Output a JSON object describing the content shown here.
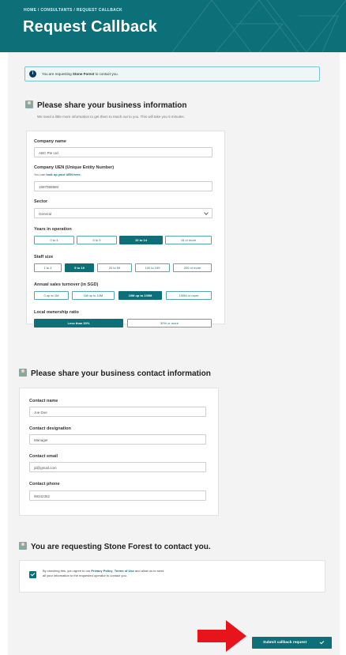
{
  "header": {
    "breadcrumb": [
      "HOME",
      "CONSULTANTS",
      "REQUEST CALLBACK"
    ],
    "breadcrumb_sep": "/",
    "title": "Request Callback"
  },
  "notice": {
    "prefix": "You are requesting ",
    "company": "Stone Forest",
    "suffix": " to contact you."
  },
  "business": {
    "title": "Please share your business information",
    "subtitle": "We need a little more information to get them to reach out to you. This will take you 5 minutes.",
    "company_name": {
      "label": "Company name",
      "value": "ABC Pte Ltd"
    },
    "uen": {
      "label": "Company UEN (Unique Entity Number)",
      "helper_prefix": "You can ",
      "helper_link": "look up your UEN here.",
      "value": "19970859IM"
    },
    "sector": {
      "label": "Sector",
      "value": "General"
    },
    "years": {
      "label": "Years in operation",
      "options": [
        "0 to 4",
        "5 to 9",
        "10 to 14",
        "15 or more"
      ],
      "selected": "10 to 14"
    },
    "staff": {
      "label": "Staff size",
      "options": [
        "1 to 4",
        "5 to 19",
        "20 to 99",
        "100 to 199",
        "200 or more"
      ],
      "selected": "5 to 19"
    },
    "turnover": {
      "label": "Annual sales turnover (in SGD)",
      "options": [
        "0 up to 1M",
        "1M up to 10M",
        "10M up to 100M",
        "100M or more"
      ],
      "selected": "10M up to 100M"
    },
    "ownership": {
      "label": "Local ownership ratio",
      "options": [
        "Less than 30%",
        "30% or more"
      ],
      "selected": "Less than 30%"
    }
  },
  "contact": {
    "title": "Please share your business contact information",
    "name": {
      "label": "Contact name",
      "value": "Joe Doe"
    },
    "designation": {
      "label": "Contact designation",
      "value": "Manager"
    },
    "email": {
      "label": "Contact email",
      "value": "jd@gmail.com"
    },
    "phone": {
      "label": "Contact phone",
      "value": "98342352"
    }
  },
  "consent": {
    "title": "You are requesting Stone Forest to contact you.",
    "text_1": "By checking this, you agree to our ",
    "privacy_link": "Privacy Policy",
    "comma": ", ",
    "terms_link": "Terms of Use",
    "text_2": " and allow us to send",
    "text_3": "all your information to the requested operator to contact you.",
    "checked": true
  },
  "submit": {
    "label": "Submit callback request"
  },
  "colors": {
    "primary": "#0d6f78",
    "arrow": "#e8141c",
    "notice_bg": "#eef6f8"
  }
}
